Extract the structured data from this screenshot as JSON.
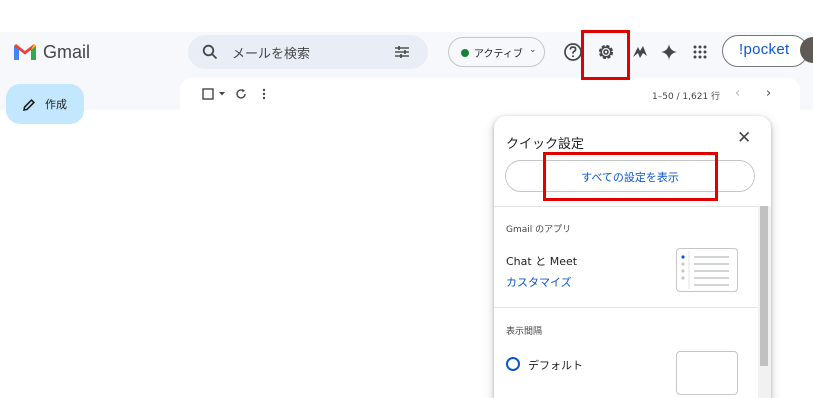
{
  "app": {
    "name": "Gmail"
  },
  "search": {
    "placeholder": "メールを検索"
  },
  "status": {
    "label": "アクティブ",
    "color": "#188038"
  },
  "header_icons": [
    "help-icon",
    "settings-icon",
    "extension-icon",
    "gemini-icon",
    "apps-grid-icon"
  ],
  "extension": {
    "label": "!pocket"
  },
  "compose": {
    "label": "作成"
  },
  "toolbar": {
    "pager": "1–50 / 1,621 行"
  },
  "quick_settings": {
    "title": "クイック設定",
    "all_settings_label": "すべての設定を表示",
    "sections": {
      "apps": {
        "title": "Gmail のアプリ",
        "chat_meet": "Chat と Meet",
        "customize": "カスタマイズ"
      },
      "density": {
        "title": "表示間隔",
        "option_label": "デフォルト"
      }
    }
  },
  "colors": {
    "accent": "#0b57d0",
    "highlight": "#e00000",
    "compose_bg": "#c2e7ff",
    "header_bg": "#f6f8fc"
  }
}
